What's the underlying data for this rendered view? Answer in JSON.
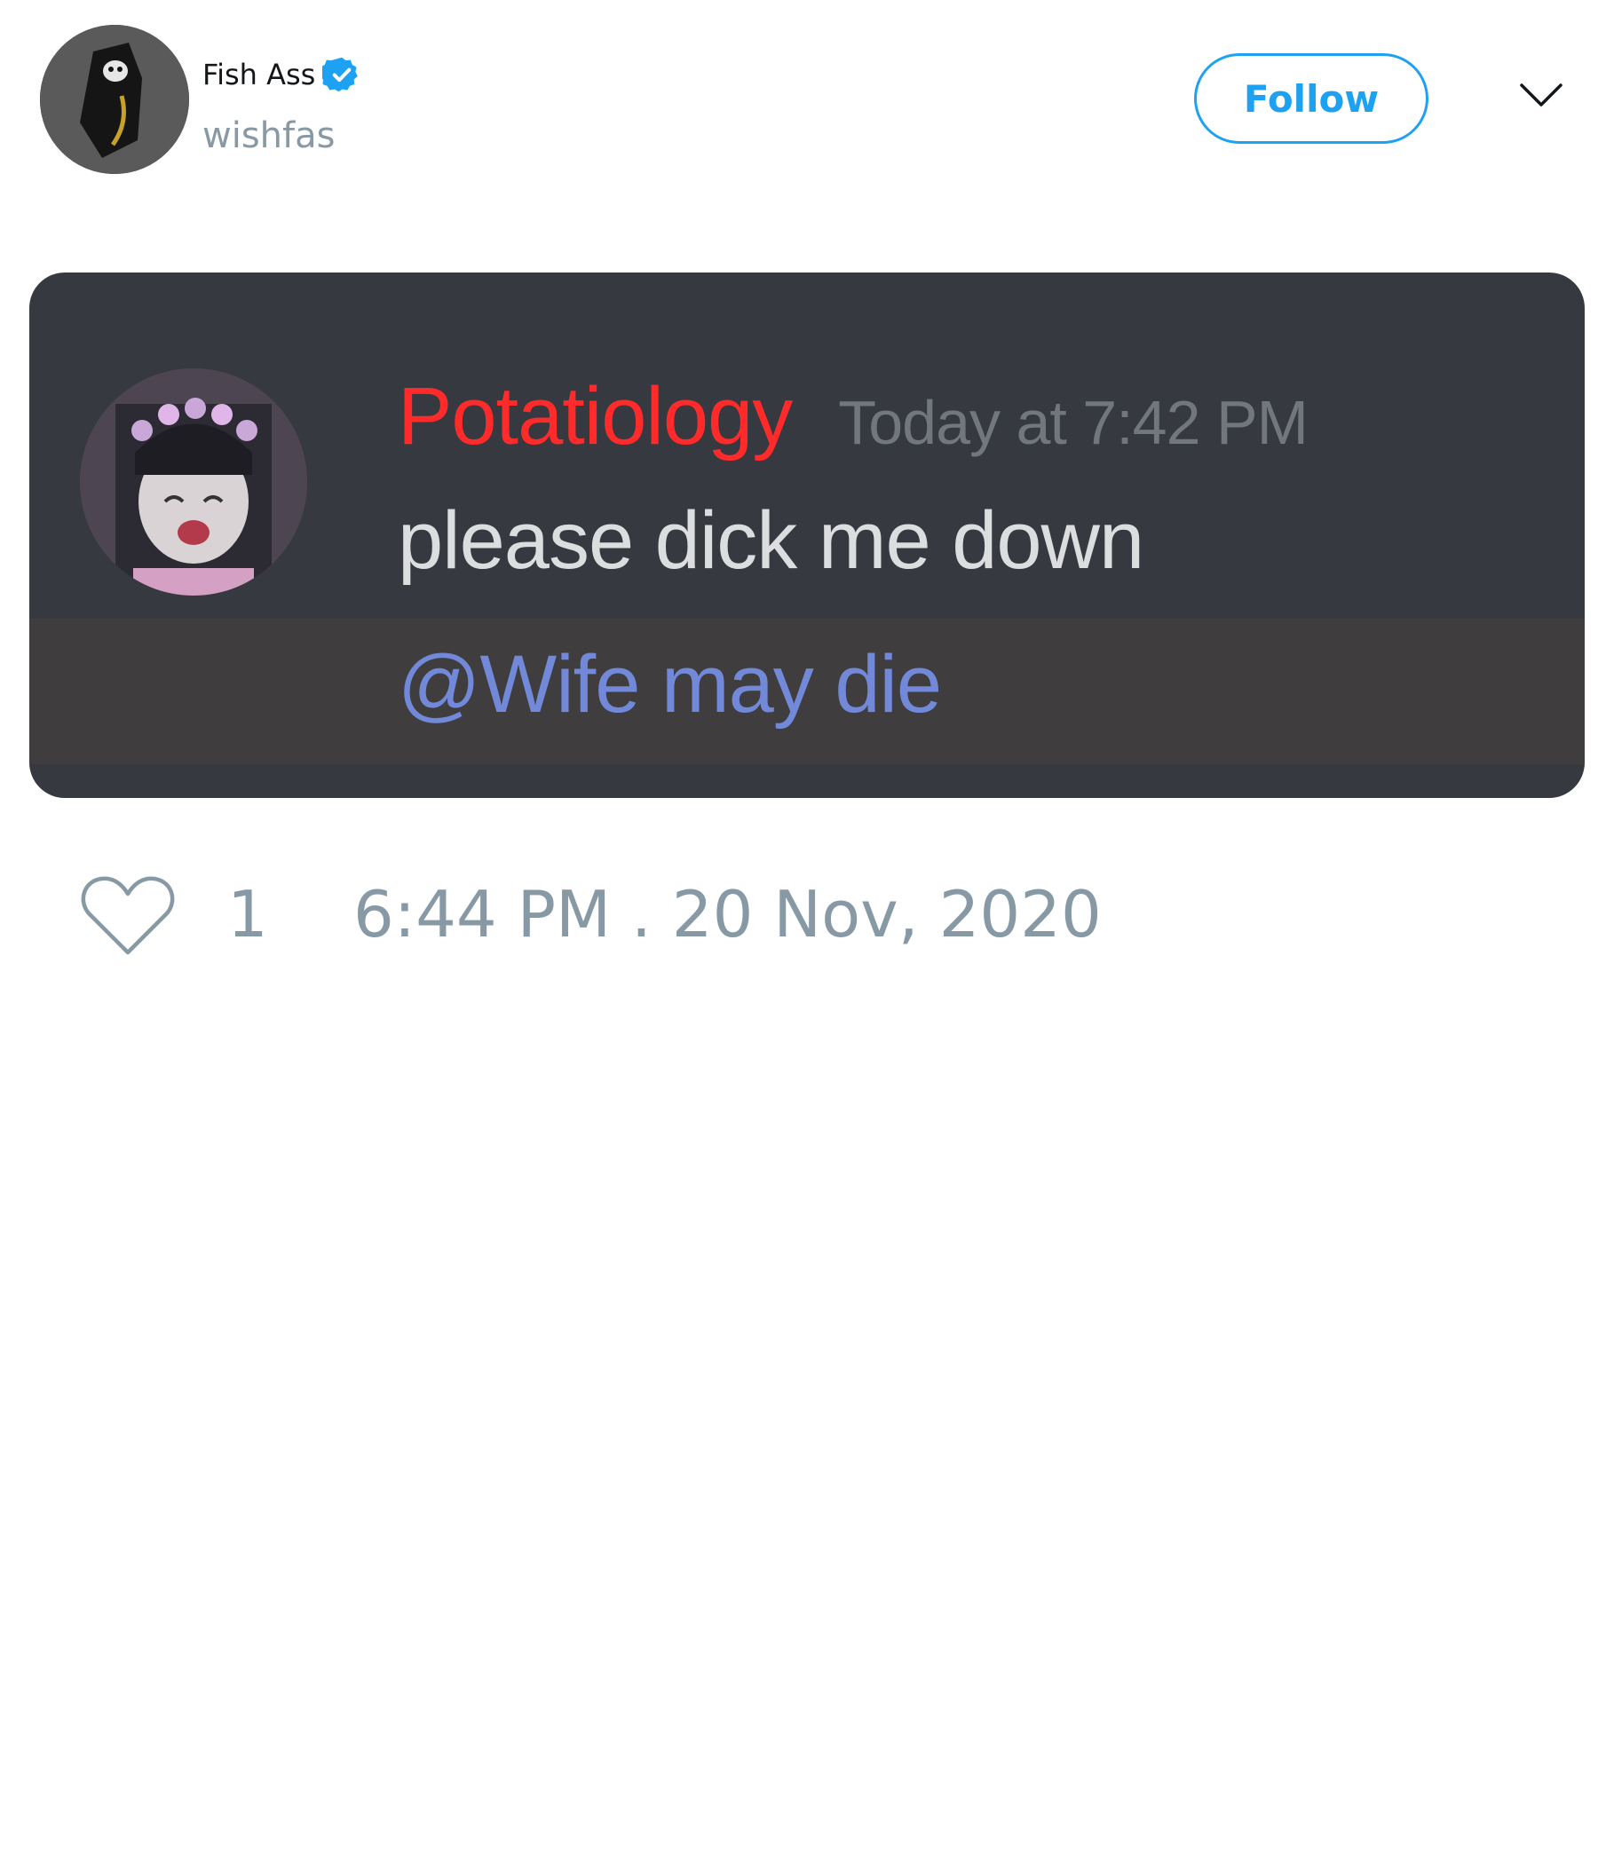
{
  "tweet": {
    "author": {
      "display_name": "Fish Ass",
      "handle": "wishfas",
      "verified": true,
      "avatar_icon": "avatar-image"
    },
    "follow_label": "Follow",
    "menu_icon": "chevron-down-icon",
    "embedded_image": {
      "username": "Potatiology",
      "timestamp": "Today at 7:42 PM",
      "message": "please dick me down",
      "mention": "@Wife may die",
      "colors": {
        "background": "#36393f",
        "mention_row": "#3f3d3d",
        "username": "#ff2a2a",
        "mention": "#7289da"
      }
    },
    "likes": "1",
    "posted_at": "6:44 PM . 20 Nov, 2020",
    "accent_color": "#1da1f2"
  }
}
